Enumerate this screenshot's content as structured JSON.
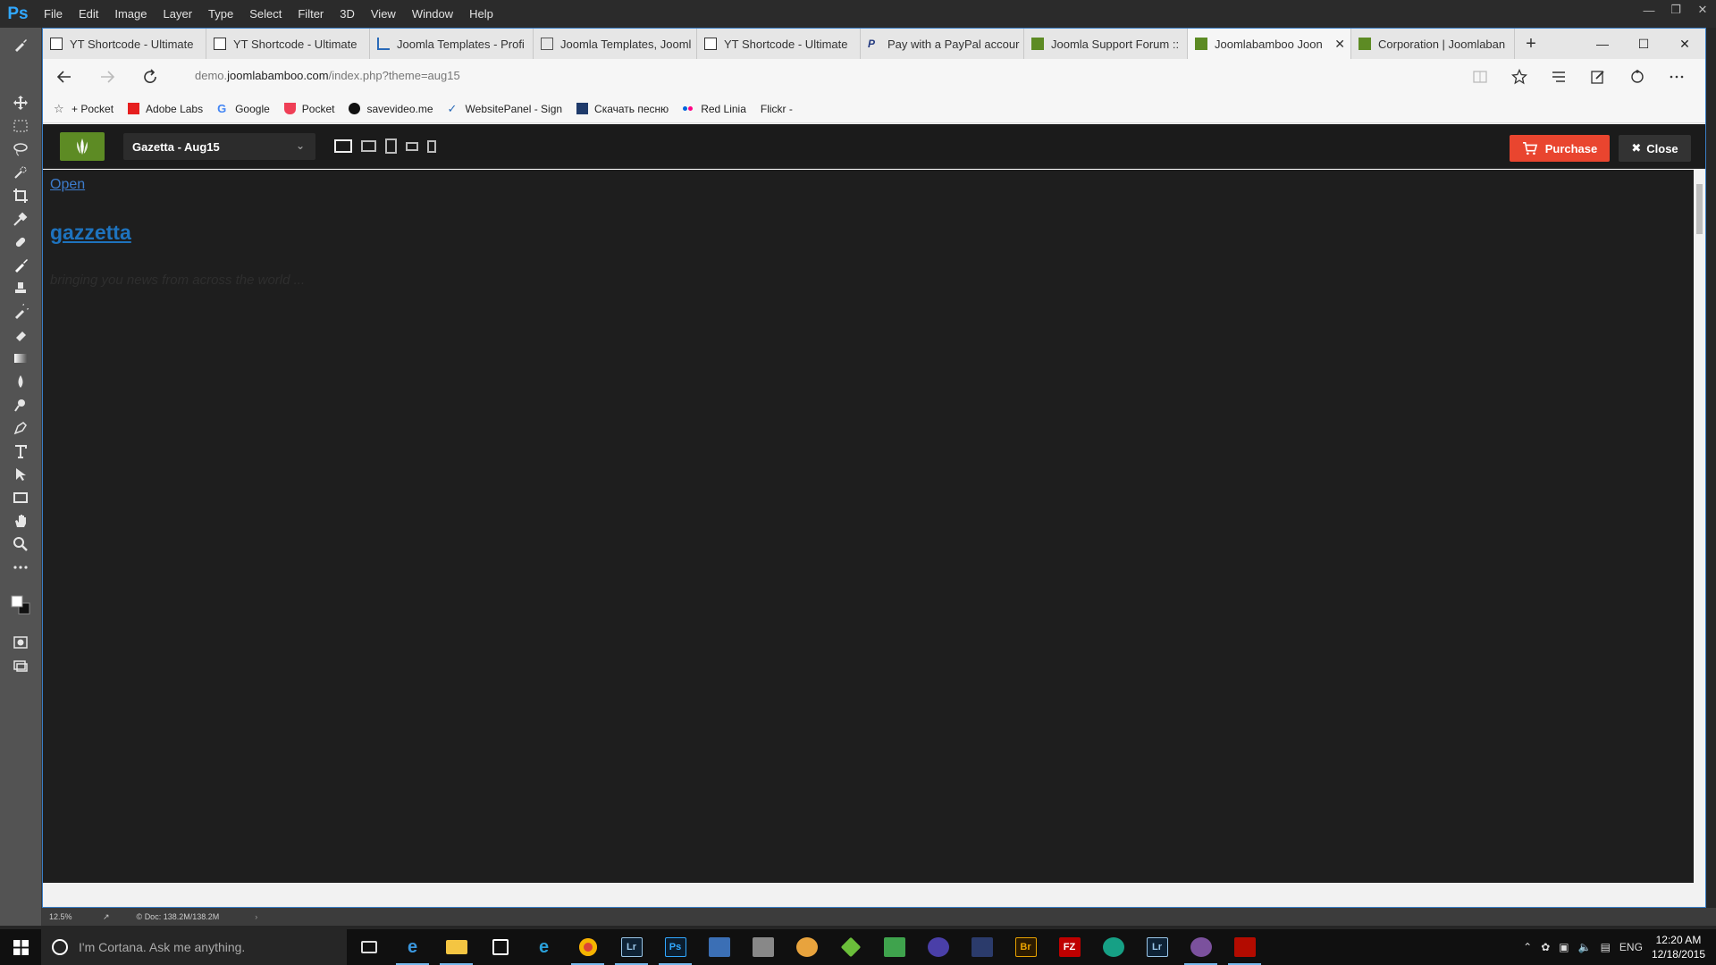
{
  "photoshop": {
    "logo": "Ps",
    "menus": [
      "File",
      "Edit",
      "Image",
      "Layer",
      "Type",
      "Select",
      "Filter",
      "3D",
      "View",
      "Window",
      "Help"
    ],
    "status": {
      "zoom": "12.5%",
      "doc": "Doc: 138.2M/138.2M"
    }
  },
  "browser": {
    "tabs": [
      {
        "label": "YT Shortcode - Ultimate"
      },
      {
        "label": "YT Shortcode - Ultimate"
      },
      {
        "label": "Joomla Templates - Profi"
      },
      {
        "label": "Joomla Templates, Jooml"
      },
      {
        "label": "YT Shortcode - Ultimate"
      },
      {
        "label": "Pay with a PayPal accour"
      },
      {
        "label": "Joomla Support Forum ::"
      },
      {
        "label": "Joomlabamboo Joon",
        "active": true
      },
      {
        "label": "Corporation | Joomlaban"
      }
    ],
    "address": {
      "prefix": "demo.",
      "domain": "joomlabamboo.com",
      "path": "/index.php?theme=aug15"
    },
    "favorites": [
      "+ Pocket",
      "Adobe Labs",
      "Google",
      "Pocket",
      "savevideo.me",
      "WebsitePanel - Sign",
      "Скачать песню",
      "Red Linia",
      "Flickr -"
    ]
  },
  "demo_bar": {
    "theme_select": "Gazetta - Aug15",
    "purchase_label": "Purchase",
    "close_label": "Close"
  },
  "page": {
    "open_link": "Open",
    "site_title": "gazzetta",
    "tagline": "bringing you news from across the world ..."
  },
  "taskbar": {
    "cortana_placeholder": "I'm Cortana. Ask me anything.",
    "language": "ENG",
    "time": "12:20 AM",
    "date": "12/18/2015"
  }
}
